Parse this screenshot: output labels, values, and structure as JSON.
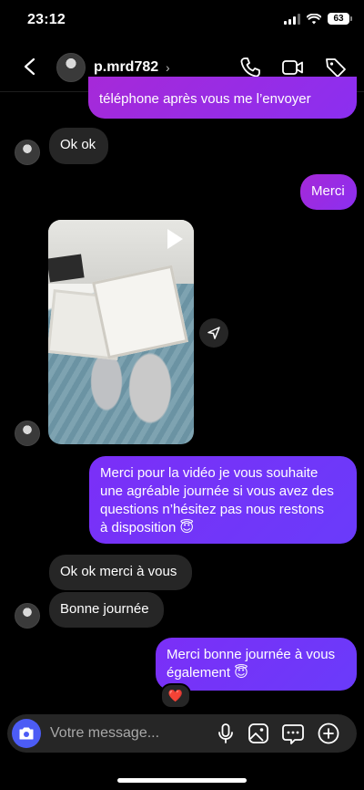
{
  "status": {
    "time": "23:12",
    "battery": "63"
  },
  "header": {
    "username": "p.mrd782",
    "chevron": "›"
  },
  "messages": {
    "m0": "téléphone après vous me l’envoyer",
    "m1": "Ok ok",
    "m2": "Merci",
    "m3_line1": "Merci pour la vidéo je vous souhaite",
    "m3_line2": "une agréable journée si vous avez des",
    "m3_line3": "questions n’hésitez pas nous restons",
    "m3_line4": "à disposition 😇",
    "m4": "Ok ok merci à vous",
    "m5": "Bonne journée",
    "m6_line1": "Merci bonne journée à vous",
    "m6_line2": "également 😇",
    "reaction": "❤️"
  },
  "composer": {
    "placeholder": "Votre message..."
  },
  "colors": {
    "outgoing": "#6a3bfa",
    "incoming": "#262626",
    "camera": "#4c5cf5"
  }
}
